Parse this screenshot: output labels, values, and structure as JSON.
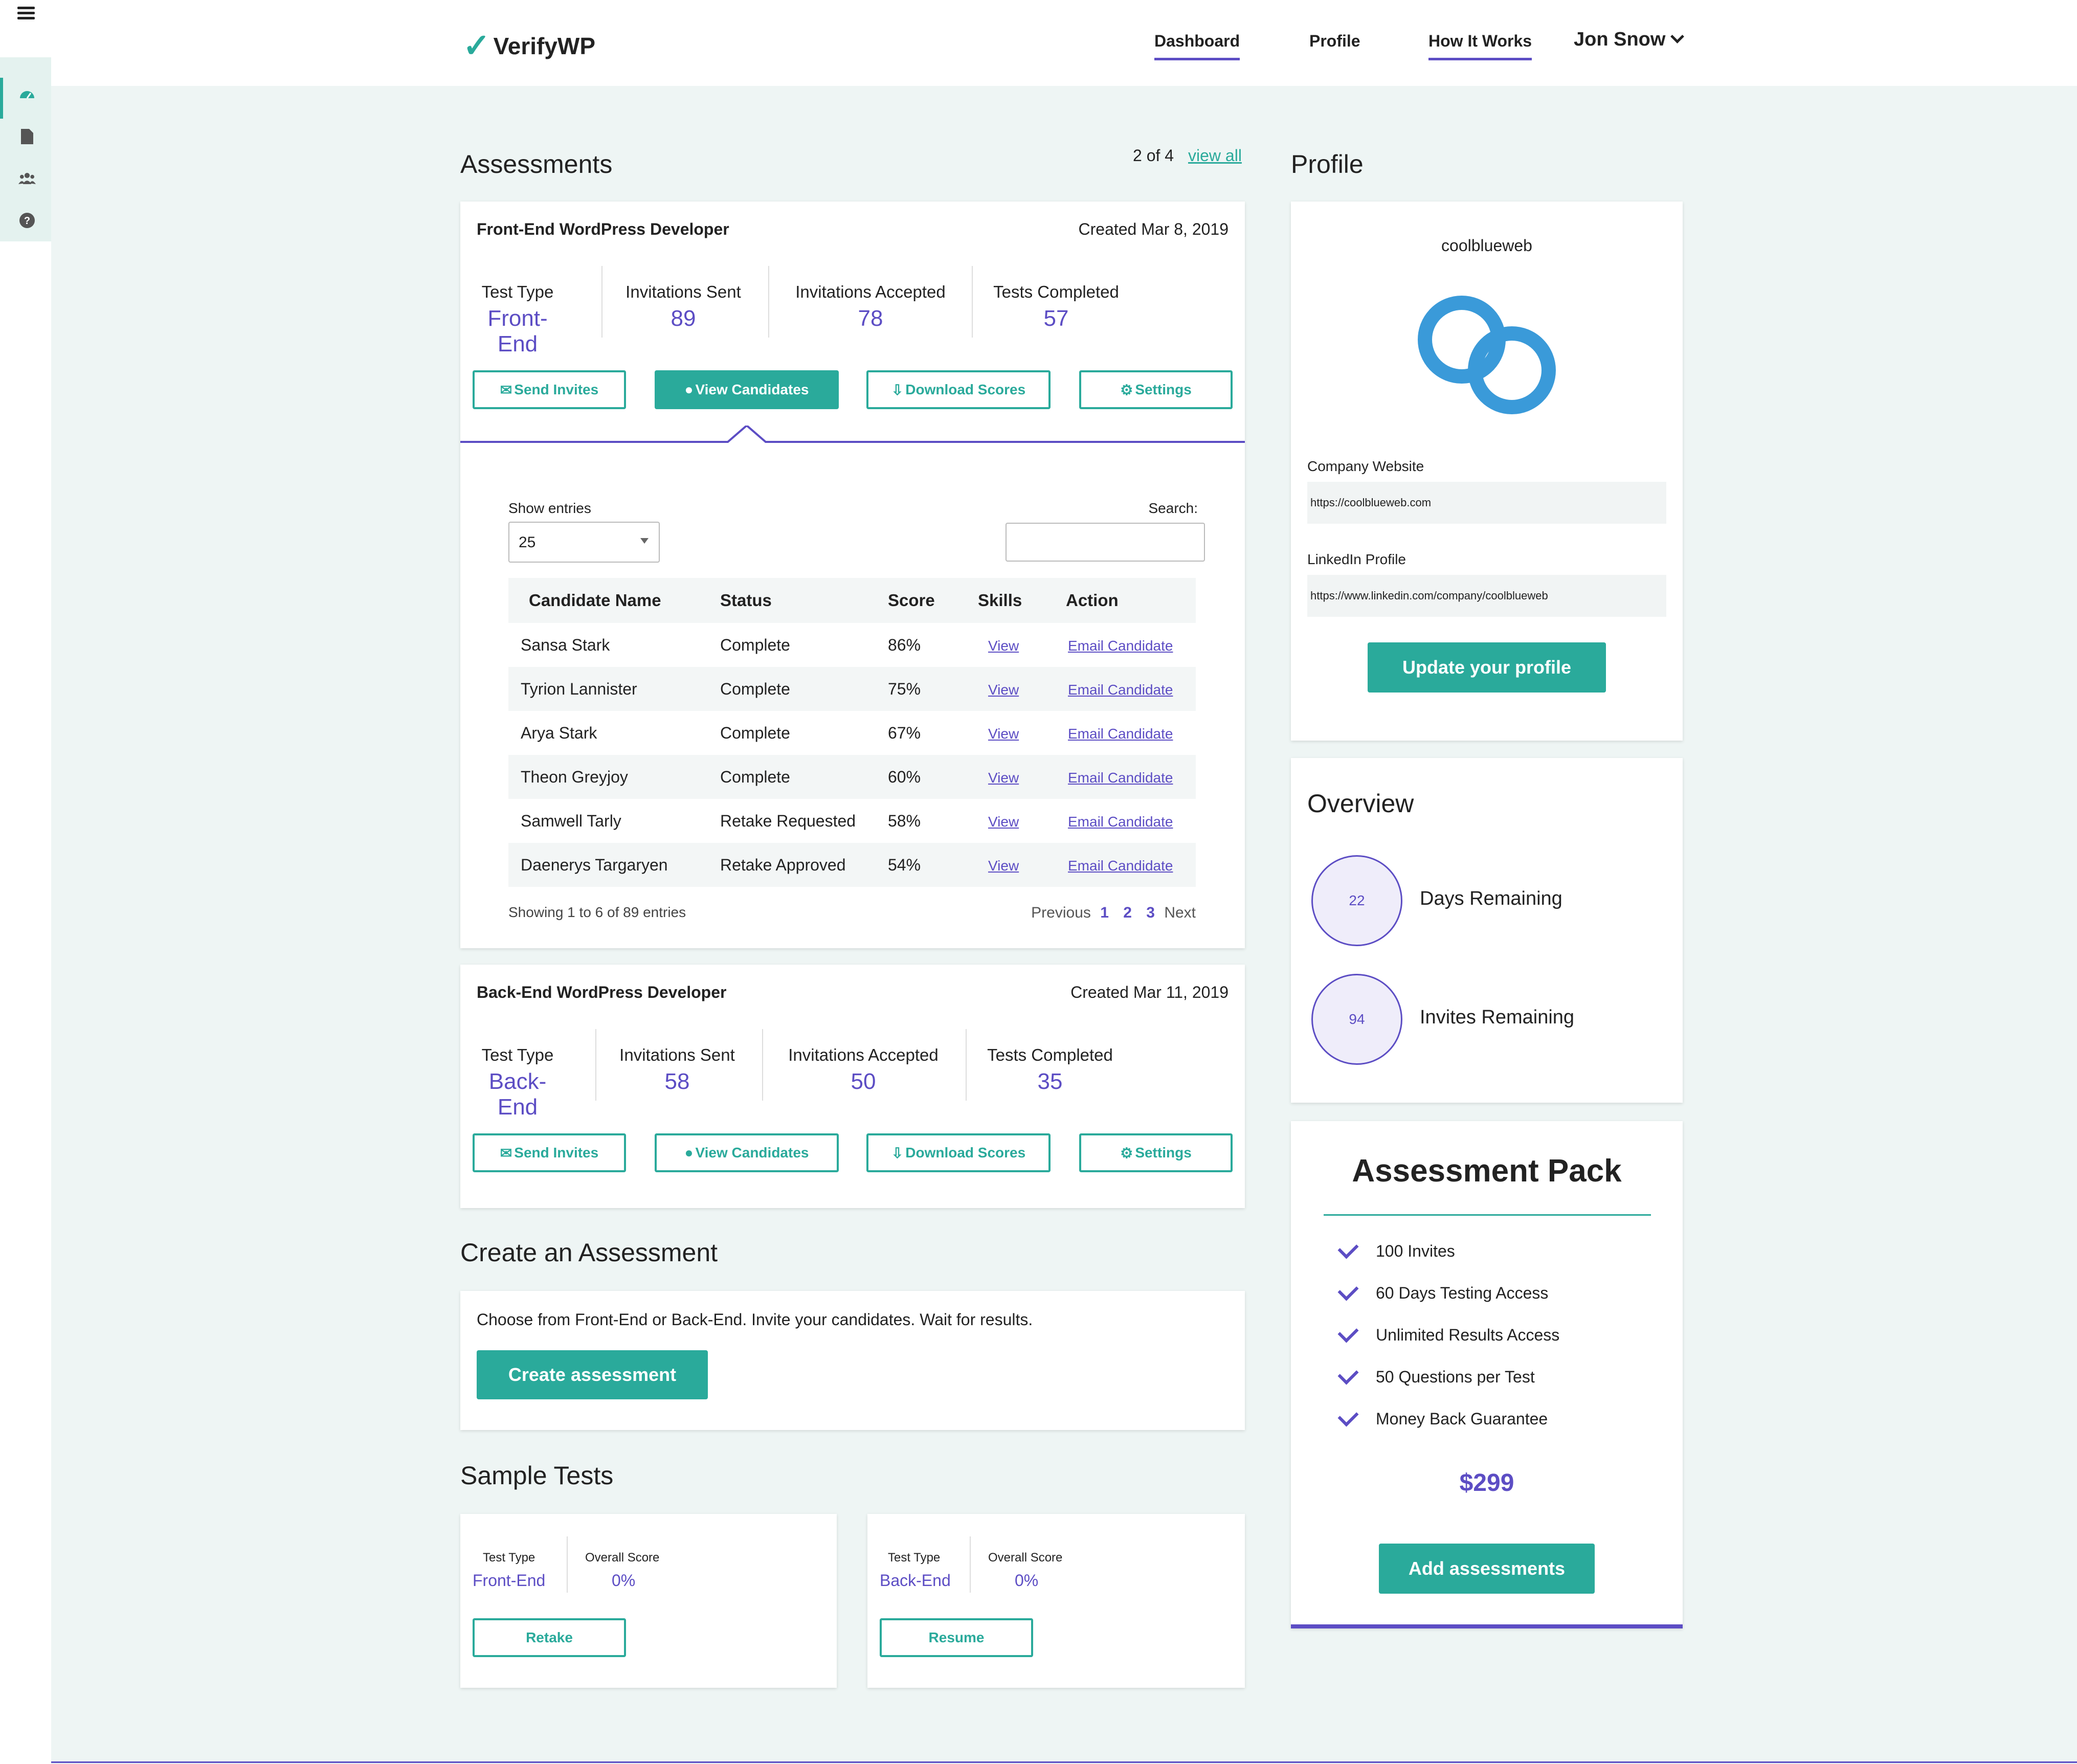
{
  "app": {
    "name": "VerifyWP"
  },
  "nav": {
    "dashboard": "Dashboard",
    "profile": "Profile",
    "how_it_works": "How It Works",
    "user": "Jon Snow"
  },
  "sidebar": {
    "icons": [
      "dashboard-icon",
      "document-icon",
      "users-icon",
      "help-icon"
    ]
  },
  "assessments": {
    "title": "Assessments",
    "count": "2 of 4",
    "view_all": "view all",
    "cards": [
      {
        "title": "Front-End WordPress Developer",
        "created": "Created Mar 8, 2019",
        "stats": [
          {
            "label": "Test Type",
            "value": "Front-End"
          },
          {
            "label": "Invitations Sent",
            "value": "89"
          },
          {
            "label": "Invitations Accepted",
            "value": "78"
          },
          {
            "label": "Tests Completed",
            "value": "57"
          }
        ],
        "buttons": {
          "send": "Send Invites",
          "view": "View Candidates",
          "download": "Download Scores",
          "settings": "Settings"
        }
      },
      {
        "title": "Back-End WordPress Developer",
        "created": "Created Mar 11, 2019",
        "stats": [
          {
            "label": "Test Type",
            "value": "Back-End"
          },
          {
            "label": "Invitations Sent",
            "value": "58"
          },
          {
            "label": "Invitations Accepted",
            "value": "50"
          },
          {
            "label": "Tests Completed",
            "value": "35"
          }
        ],
        "buttons": {
          "send": "Send Invites",
          "view": "View Candidates",
          "download": "Download Scores",
          "settings": "Settings"
        }
      }
    ]
  },
  "table": {
    "show_entries": "Show entries",
    "entries_value": "25",
    "search_label": "Search:",
    "search_value": "",
    "headers": [
      "Candidate Name",
      "Status",
      "Score",
      "Skills",
      "Action"
    ],
    "rows": [
      {
        "name": "Sansa Stark",
        "status": "Complete",
        "score": "86%",
        "skills": "View",
        "action": "Email Candidate"
      },
      {
        "name": "Tyrion Lannister",
        "status": "Complete",
        "score": "75%",
        "skills": "View",
        "action": "Email Candidate"
      },
      {
        "name": "Arya Stark",
        "status": "Complete",
        "score": "67%",
        "skills": "View",
        "action": "Email Candidate"
      },
      {
        "name": "Theon Greyjoy",
        "status": "Complete",
        "score": "60%",
        "skills": "View",
        "action": "Email Candidate"
      },
      {
        "name": "Samwell Tarly",
        "status": "Retake Requested",
        "score": "58%",
        "skills": "View",
        "action": "Email Candidate"
      },
      {
        "name": "Daenerys Targaryen",
        "status": "Retake Approved",
        "score": "54%",
        "skills": "View",
        "action": "Email Candidate"
      }
    ],
    "showing": "Showing 1 to 6 of 89 entries",
    "pager": {
      "previous": "Previous",
      "pages": [
        "1",
        "2",
        "3"
      ],
      "next": "Next"
    }
  },
  "create": {
    "title": "Create an Assessment",
    "text": "Choose from Front-End or Back-End. Invite your candidates. Wait for results.",
    "button": "Create assessment"
  },
  "samples": {
    "title": "Sample Tests",
    "items": [
      {
        "type_label": "Test Type",
        "type": "Front-End",
        "score_label": "Overall Score",
        "score": "0%",
        "button": "Retake"
      },
      {
        "type_label": "Test Type",
        "type": "Back-End",
        "score_label": "Overall Score",
        "score": "0%",
        "button": "Resume"
      }
    ]
  },
  "profile": {
    "title": "Profile",
    "company": "coolblueweb",
    "website_label": "Company Website",
    "website": "https://coolblueweb.com",
    "linkedin_label": "LinkedIn Profile",
    "linkedin": "https://www.linkedin.com/company/coolblueweb",
    "button": "Update your profile",
    "logo_color": "#3a9ad9"
  },
  "overview": {
    "title": "Overview",
    "days": {
      "value": "22",
      "label": "Days Remaining"
    },
    "invites": {
      "value": "94",
      "label": "Invites Remaining"
    }
  },
  "pack": {
    "title": "Assessment Pack",
    "items": [
      "100 Invites",
      "60 Days Testing Access",
      "Unlimited Results Access",
      "50 Questions per Test",
      "Money Back Guarantee"
    ],
    "price": "$299",
    "button": "Add assessments"
  },
  "colors": {
    "accent": "#2aaa9b",
    "purple": "#5c4dc4",
    "background": "#eef5f4"
  }
}
